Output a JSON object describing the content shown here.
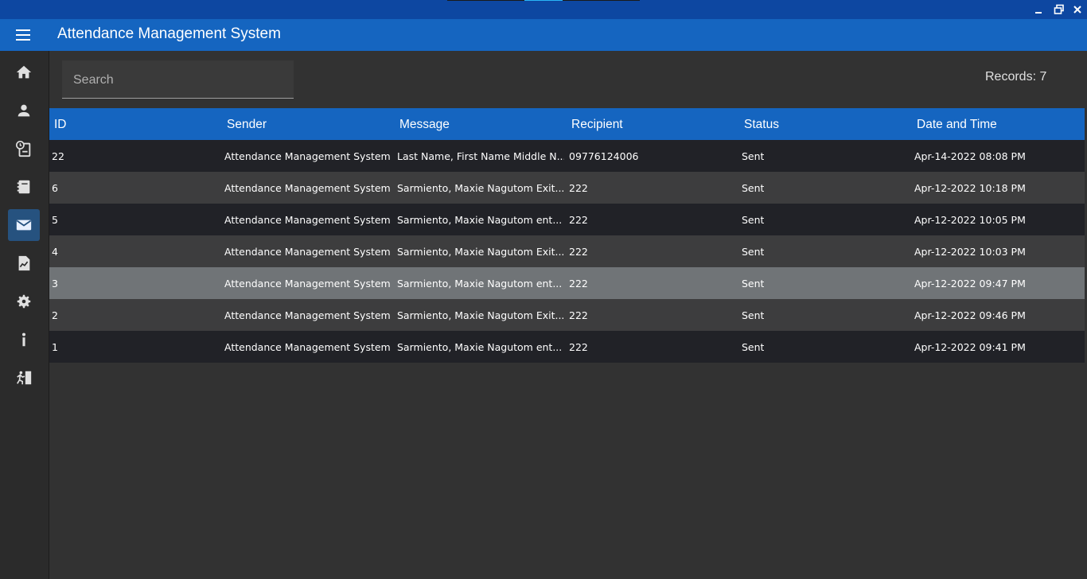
{
  "window": {
    "minimize_icon": "minimize-icon",
    "restore_icon": "restore-icon",
    "close_icon": "close-icon"
  },
  "app": {
    "title": "Attendance Management System",
    "menu_icon": "hamburger-icon"
  },
  "sidebar": {
    "items": [
      {
        "name": "home",
        "icon": "home-icon"
      },
      {
        "name": "students",
        "icon": "person-icon"
      },
      {
        "name": "attendance",
        "icon": "clock-clipboard-icon"
      },
      {
        "name": "records",
        "icon": "book-icon"
      },
      {
        "name": "messages",
        "icon": "mail-icon",
        "active": true
      },
      {
        "name": "reports",
        "icon": "report-icon"
      },
      {
        "name": "settings",
        "icon": "gear-icon"
      },
      {
        "name": "about",
        "icon": "info-icon"
      },
      {
        "name": "exit",
        "icon": "exit-icon"
      }
    ]
  },
  "search": {
    "placeholder": "Search",
    "value": ""
  },
  "records_label": "Records: 7",
  "table": {
    "columns": [
      "ID",
      "Sender",
      "Message",
      "Recipient",
      "Status",
      "Date and Time"
    ],
    "rows": [
      [
        "22",
        "Attendance Management System",
        "Last Name, First Name Middle N...",
        "09776124006",
        "Sent",
        "Apr-14-2022 08:08 PM"
      ],
      [
        "6",
        "Attendance Management System",
        "Sarmiento, Maxie Nagutom  Exit...",
        "222",
        "Sent",
        "Apr-12-2022 10:18 PM"
      ],
      [
        "5",
        "Attendance Management System",
        "Sarmiento, Maxie Nagutom  ent...",
        "222",
        "Sent",
        "Apr-12-2022 10:05 PM"
      ],
      [
        "4",
        "Attendance Management System",
        "Sarmiento, Maxie Nagutom  Exit...",
        "222",
        "Sent",
        "Apr-12-2022 10:03 PM"
      ],
      [
        "3",
        "Attendance Management System",
        "Sarmiento, Maxie Nagutom  ent...",
        "222",
        "Sent",
        "Apr-12-2022 09:47 PM"
      ],
      [
        "2",
        "Attendance Management System",
        "Sarmiento, Maxie Nagutom  Exit...",
        "222",
        "Sent",
        "Apr-12-2022 09:46 PM"
      ],
      [
        "1",
        "Attendance Management System",
        "Sarmiento, Maxie Nagutom  ent...",
        "222",
        "Sent",
        "Apr-12-2022 09:41 PM"
      ]
    ],
    "selected_row": 4
  },
  "colors": {
    "appbar": "#1565c0",
    "titlebar": "#0d47a1",
    "background": "#323232",
    "active_nav": "#26527f"
  }
}
